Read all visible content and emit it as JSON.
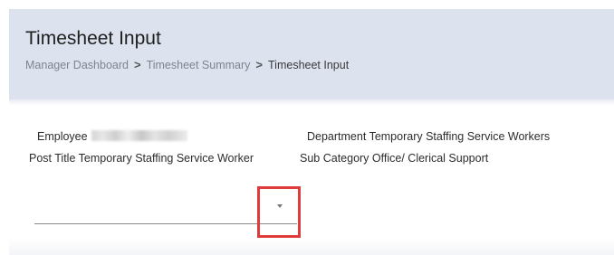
{
  "header": {
    "title": "Timesheet Input",
    "breadcrumb": {
      "items": [
        "Manager Dashboard",
        "Timesheet Summary"
      ],
      "current": "Timesheet Input",
      "separator": ">"
    }
  },
  "employee_info": {
    "employee_label": "Employee",
    "employee_value_redacted": true,
    "post_title_label": "Post Title",
    "post_title_value": "Temporary Staffing Service Worker",
    "department_label": "Department",
    "department_value": "Temporary Staffing Service Workers",
    "sub_category_label": "Sub Category",
    "sub_category_value": "Office/ Clerical Support"
  },
  "select": {
    "value": "",
    "icon": "chevron-down-icon"
  },
  "colors": {
    "header_bg": "#dde3ee",
    "highlight": "#e03b3b",
    "breadcrumb_link": "#7d8590"
  }
}
